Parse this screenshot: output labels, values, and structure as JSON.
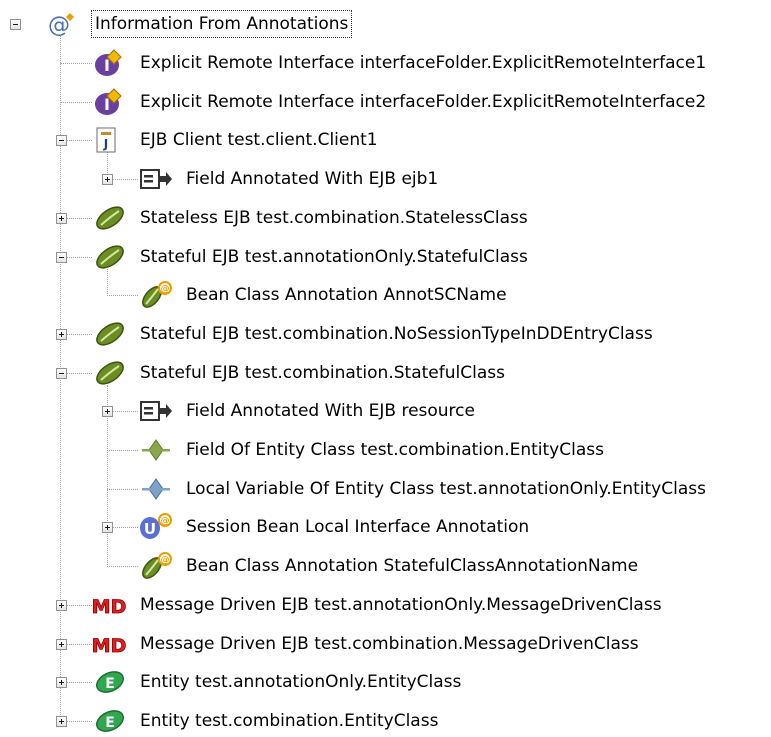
{
  "tree": {
    "root": {
      "label": "Information From Annotations",
      "icon": "annotation-info-icon",
      "expanded": true,
      "children": [
        {
          "label": "Explicit Remote Interface interfaceFolder.ExplicitRemoteInterface1",
          "icon": "remote-interface-icon",
          "expandable": false,
          "expanded": false,
          "children": []
        },
        {
          "label": "Explicit Remote Interface interfaceFolder.ExplicitRemoteInterface2",
          "icon": "remote-interface-icon",
          "expandable": false,
          "expanded": false,
          "children": []
        },
        {
          "label": "EJB Client test.client.Client1",
          "icon": "ejb-client-icon",
          "expandable": true,
          "expanded": true,
          "children": [
            {
              "label": "Field Annotated With EJB ejb1",
              "icon": "annotated-field-icon",
              "expandable": true,
              "expanded": false,
              "children": []
            }
          ]
        },
        {
          "label": "Stateless EJB test.combination.StatelessClass",
          "icon": "session-bean-icon",
          "expandable": true,
          "expanded": false,
          "children": []
        },
        {
          "label": "Stateful EJB test.annotationOnly.StatefulClass",
          "icon": "session-bean-icon",
          "expandable": true,
          "expanded": true,
          "children": [
            {
              "label": "Bean Class Annotation AnnotSCName",
              "icon": "bean-class-annotation-icon",
              "expandable": false,
              "expanded": false,
              "children": []
            }
          ]
        },
        {
          "label": "Stateful EJB test.combination.NoSessionTypeInDDEntryClass",
          "icon": "session-bean-icon",
          "expandable": true,
          "expanded": false,
          "children": []
        },
        {
          "label": "Stateful EJB test.combination.StatefulClass",
          "icon": "session-bean-icon",
          "expandable": true,
          "expanded": true,
          "children": [
            {
              "label": "Field Annotated With EJB resource",
              "icon": "annotated-field-icon",
              "expandable": true,
              "expanded": false,
              "children": []
            },
            {
              "label": "Field Of Entity Class test.combination.EntityClass",
              "icon": "field-icon",
              "expandable": false,
              "expanded": false,
              "children": []
            },
            {
              "label": "Local Variable Of Entity Class test.annotationOnly.EntityClass",
              "icon": "local-variable-icon",
              "expandable": false,
              "expanded": false,
              "children": []
            },
            {
              "label": "Session Bean Local Interface Annotation",
              "icon": "local-interface-annotation-icon",
              "expandable": true,
              "expanded": false,
              "children": []
            },
            {
              "label": "Bean Class Annotation StatefulClassAnnotationName",
              "icon": "bean-class-annotation-icon",
              "expandable": false,
              "expanded": false,
              "children": []
            }
          ]
        },
        {
          "label": "Message Driven EJB test.annotationOnly.MessageDrivenClass",
          "icon": "message-driven-bean-icon",
          "expandable": true,
          "expanded": false,
          "children": []
        },
        {
          "label": "Message Driven EJB test.combination.MessageDrivenClass",
          "icon": "message-driven-bean-icon",
          "expandable": true,
          "expanded": false,
          "children": []
        },
        {
          "label": "Entity test.annotationOnly.EntityClass",
          "icon": "entity-bean-icon",
          "expandable": true,
          "expanded": false,
          "children": []
        },
        {
          "label": "Entity test.combination.EntityClass",
          "icon": "entity-bean-icon",
          "expandable": true,
          "expanded": false,
          "children": []
        }
      ]
    },
    "colors": {
      "connector": "#a0a0a0",
      "remote_interface": "#6a3fa0",
      "session_bean": "#6b8e23",
      "message_driven": "#e02020",
      "entity_bean": "#2fa84f",
      "field_green": "#8aa64c",
      "field_blue": "#7ea3c9",
      "annotation_badge": "#e8a000"
    }
  }
}
